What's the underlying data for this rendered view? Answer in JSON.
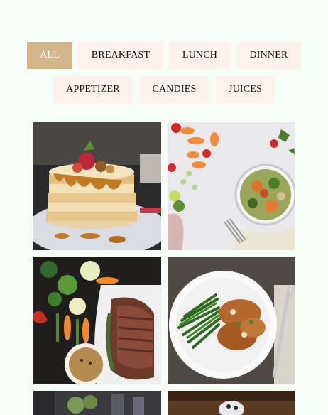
{
  "filters": [
    {
      "label": "ALL",
      "active": true
    },
    {
      "label": "BREAKFAST",
      "active": false
    },
    {
      "label": "LUNCH",
      "active": false
    },
    {
      "label": "DINNER",
      "active": false
    },
    {
      "label": "APPETIZER",
      "active": false
    },
    {
      "label": "CANDIES",
      "active": false
    },
    {
      "label": "JUICES",
      "active": false
    }
  ],
  "gallery": {
    "items": [
      {
        "subject": "pancake-stack-photo"
      },
      {
        "subject": "vegetable-plate-photo"
      },
      {
        "subject": "steak-with-vegetables-photo"
      },
      {
        "subject": "chicken-and-green-beans-photo"
      },
      {
        "subject": "drinks-photo"
      },
      {
        "subject": "dessert-photo"
      }
    ]
  },
  "colors": {
    "page_background": "#f5fff8",
    "active_filter": "#d4b489",
    "filter_background": "#fff1ec"
  }
}
